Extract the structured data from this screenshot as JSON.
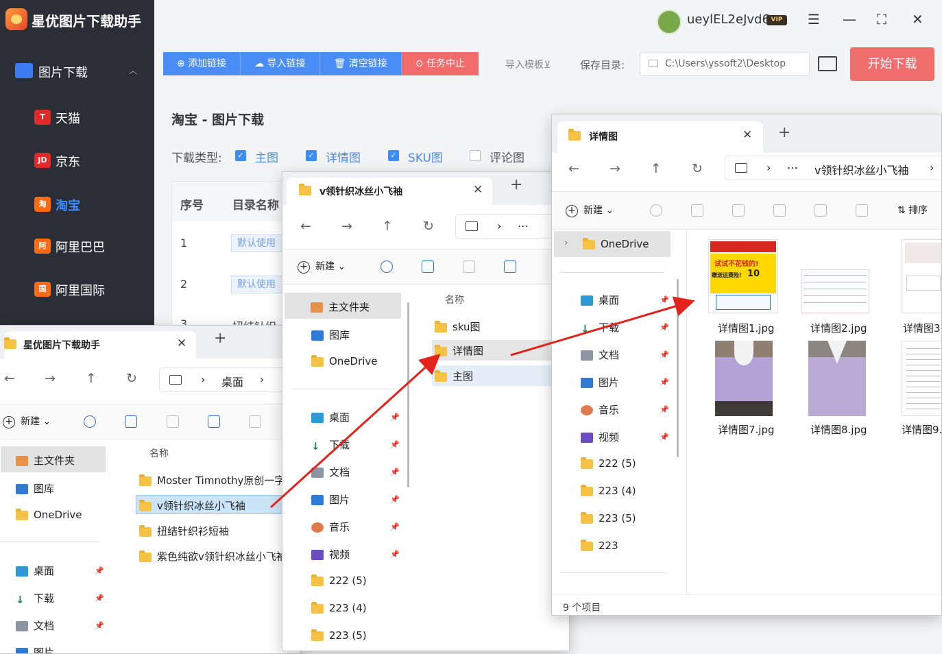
{
  "app": {
    "title": "星优图片下载助手",
    "user": "ueylEL2eJvd6",
    "vip": "VIP",
    "section": "图片下载",
    "platforms": [
      {
        "name": "天猫",
        "badge": "T",
        "color": "#e02a2a"
      },
      {
        "name": "京东",
        "badge": "JD",
        "color": "#e02a2a"
      },
      {
        "name": "淘宝",
        "badge": "淘",
        "color": "#ff6a13"
      },
      {
        "name": "阿里巴巴",
        "badge": "阿",
        "color": "#ff6a13"
      },
      {
        "name": "阿里国际",
        "badge": "国",
        "color": "#ff6a13"
      }
    ],
    "toolbar": {
      "add": "⊕ 添加链接",
      "import": "☁ 导入链接",
      "clear": "🗑 清空链接",
      "stop": "⊙ 任务中止"
    },
    "import_template": "导入模板⊻",
    "save_label": "保存目录:",
    "save_path": "C:\\Users\\yssoft2\\Desktop",
    "start": "开始下载",
    "page_title": "淘宝 - 图片下载",
    "download_type_label": "下载类型:",
    "types": [
      {
        "label": "主图",
        "checked": true
      },
      {
        "label": "详情图",
        "checked": true
      },
      {
        "label": "SKU图",
        "checked": true
      },
      {
        "label": "评论图",
        "checked": false
      }
    ],
    "table": {
      "headers": [
        "序号",
        "目录名称"
      ],
      "rows": [
        {
          "idx": "1",
          "dir": "默认使用"
        },
        {
          "idx": "2",
          "dir": "默认使用"
        },
        {
          "idx": "3",
          "dir": "扭结针织"
        }
      ]
    }
  },
  "win1": {
    "tab": "星优图片下载助手",
    "addr": [
      "桌面"
    ],
    "new": "新建",
    "col_name": "名称",
    "nav": [
      "主文件夹",
      "图库",
      "OneDrive",
      "桌面",
      "下载",
      "文档",
      "图片"
    ],
    "files": [
      "Moster Timnothy原创一字",
      "v领针织冰丝小飞袖",
      "扭结针织衫短袖",
      "紫色纯欲v领针织冰丝小飞袖"
    ]
  },
  "win2": {
    "tab": "v领针织冰丝小飞袖",
    "new": "新建",
    "col_name": "名称",
    "nav": [
      "主文件夹",
      "图库",
      "OneDrive",
      "桌面",
      "下载",
      "文档",
      "图片",
      "音乐",
      "视频",
      "222 (5)",
      "223 (4)",
      "223 (5)"
    ],
    "files": [
      "sku图",
      "详情图",
      "主图"
    ]
  },
  "win3": {
    "tab": "详情图",
    "addr": [
      "v领针织冰丝小飞袖"
    ],
    "new": "新建",
    "sort": "排序",
    "nav": [
      "OneDrive",
      "桌面",
      "下载",
      "文档",
      "图片",
      "音乐",
      "视频",
      "222 (5)",
      "223 (4)",
      "223 (5)",
      "223"
    ],
    "images": [
      "详情图1.jpg",
      "详情图2.jpg",
      "详情图3.",
      "详情图7.jpg",
      "详情图8.jpg",
      "详情图9."
    ],
    "thumb_text": {
      "t1a": "试试不花钱的!",
      "t1b": "赠送运费险!",
      "t1c": "10"
    },
    "status": "9 个项目"
  }
}
